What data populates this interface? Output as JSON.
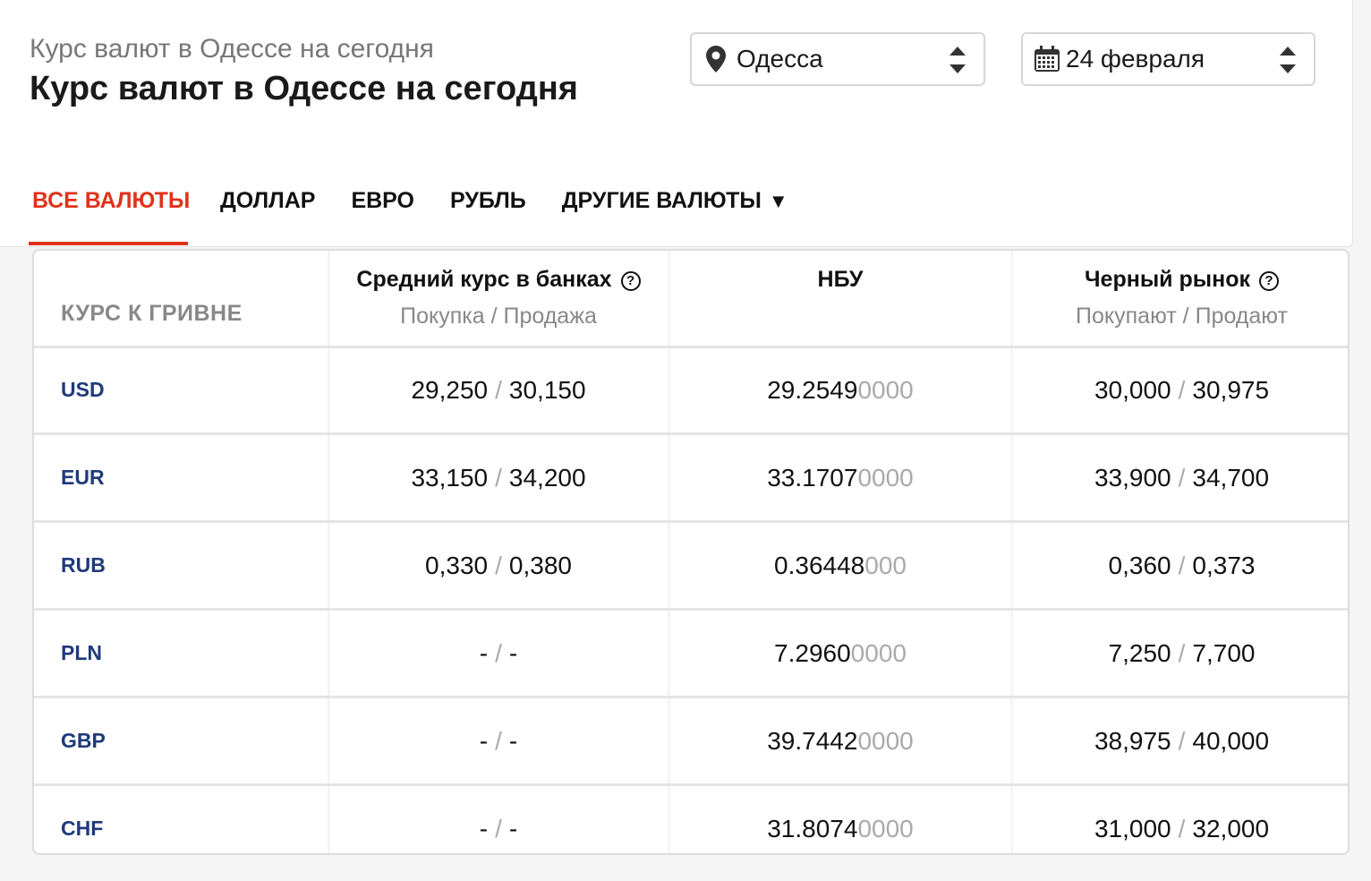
{
  "header": {
    "subtitle": "Курс валют в Одессе на сегодня",
    "title": "Курс валют в Одессе на сегодня"
  },
  "city_select": {
    "value": "Одесса",
    "icon": "map-pin-icon"
  },
  "date_select": {
    "value": "24 февраля",
    "icon": "calendar-icon"
  },
  "tabs": [
    {
      "label": "ВСЕ ВАЛЮТЫ",
      "active": true
    },
    {
      "label": "ДОЛЛАР",
      "active": false
    },
    {
      "label": "ЕВРО",
      "active": false
    },
    {
      "label": "РУБЛЬ",
      "active": false
    },
    {
      "label": "ДРУГИЕ ВАЛЮТЫ",
      "active": false,
      "caret": "▼"
    }
  ],
  "table": {
    "col0": "КУРС К ГРИВНЕ",
    "col1": {
      "title": "Средний курс в банках",
      "sub": "Покупка / Продажа"
    },
    "col2": {
      "title": "НБУ"
    },
    "col3": {
      "title": "Черный рынок",
      "sub": "Покупают / Продают"
    },
    "separator": "/",
    "rows": [
      {
        "code": "USD",
        "bank_buy": "29,250",
        "bank_sell": "30,150",
        "nbu_main": "29.2549",
        "nbu_tail": "0000",
        "black_buy": "30,000",
        "black_sell": "30,975"
      },
      {
        "code": "EUR",
        "bank_buy": "33,150",
        "bank_sell": "34,200",
        "nbu_main": "33.1707",
        "nbu_tail": "0000",
        "black_buy": "33,900",
        "black_sell": "34,700"
      },
      {
        "code": "RUB",
        "bank_buy": "0,330",
        "bank_sell": "0,380",
        "nbu_main": "0.36448",
        "nbu_tail": "000",
        "black_buy": "0,360",
        "black_sell": "0,373"
      },
      {
        "code": "PLN",
        "bank_buy": "-",
        "bank_sell": "-",
        "nbu_main": "7.2960",
        "nbu_tail": "0000",
        "black_buy": "7,250",
        "black_sell": "7,700"
      },
      {
        "code": "GBP",
        "bank_buy": "-",
        "bank_sell": "-",
        "nbu_main": "39.7442",
        "nbu_tail": "0000",
        "black_buy": "38,975",
        "black_sell": "40,000"
      },
      {
        "code": "CHF",
        "bank_buy": "-",
        "bank_sell": "-",
        "nbu_main": "31.8074",
        "nbu_tail": "0000",
        "black_buy": "31,000",
        "black_sell": "32,000"
      }
    ]
  },
  "colors": {
    "accent": "#e0321c",
    "currency_code": "#1f3a7a",
    "muted": "#888888"
  }
}
